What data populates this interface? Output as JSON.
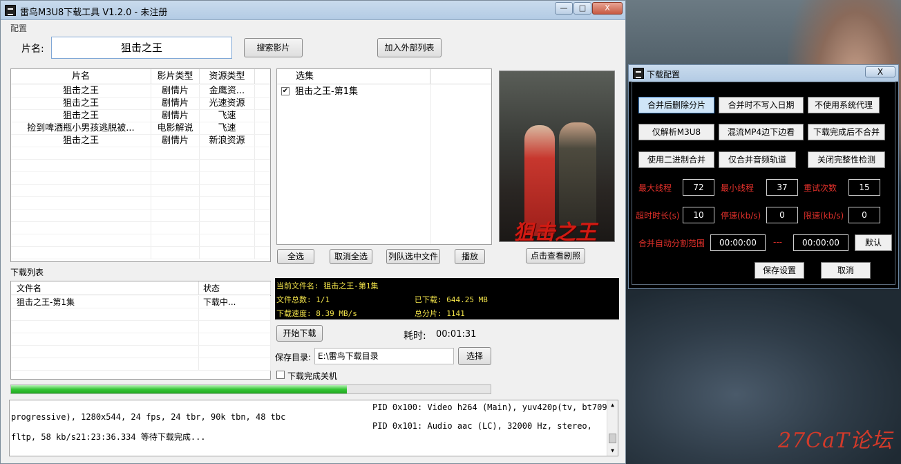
{
  "window": {
    "title": "雷鸟M3U8下载工具 V1.2.0 - 未注册",
    "minimize": "—",
    "maximize": "□",
    "close": "X"
  },
  "menu": {
    "config": "配置"
  },
  "search": {
    "label": "片名:",
    "value": "狙击之王",
    "search_button": "搜索影片",
    "add_external_button": "加入外部列表"
  },
  "results": {
    "headers": [
      "片名",
      "影片类型",
      "资源类型"
    ],
    "rows": [
      [
        "狙击之王",
        "剧情片",
        "金鹰资..."
      ],
      [
        "狙击之王",
        "剧情片",
        "光速资源"
      ],
      [
        "狙击之王",
        "剧情片",
        "飞速"
      ],
      [
        "捡到啤酒瓶小男孩逃脱被...",
        "电影解说",
        "飞速"
      ],
      [
        "狙击之王",
        "剧情片",
        "新浪资源"
      ]
    ]
  },
  "episodes": {
    "header": "选集",
    "items": [
      {
        "label": "狙击之王-第1集",
        "checked": true
      }
    ],
    "select_all": "全选",
    "deselect_all": "取消全选",
    "queue_selected": "列队选中文件",
    "play": "播放"
  },
  "poster": {
    "title_art": "狙击之王",
    "view_button": "点击查看剧照"
  },
  "downloads": {
    "section": "下载列表",
    "headers": [
      "文件名",
      "状态"
    ],
    "rows": [
      [
        "狙击之王-第1集",
        "下载中..."
      ]
    ]
  },
  "status": {
    "current_file": "当前文件名: 狙击之王-第1集",
    "total_files": "文件总数: 1/1",
    "downloaded": "已下载:  644.25 MB",
    "speed": "下载速度: 8.39 MB/s",
    "segments": "总分片: 1141"
  },
  "controls": {
    "start_button": "开始下载",
    "elapsed_label": "耗时:",
    "elapsed_value": "00:01:31",
    "save_dir_label": "保存目录:",
    "save_dir_value": "E:\\雷鸟下载目录",
    "choose_button": "选择",
    "shutdown_label": "下载完成关机",
    "shutdown_checked": false
  },
  "progress": {
    "fraction": 0.7
  },
  "log": {
    "line1": "PID 0x100: Video h264 (Main), yuv420p(tv, bt709,",
    "line2": "progressive), 1280x544, 24 fps, 24 tbr, 90k tbn, 48 tbc",
    "line3": "PID 0x101: Audio aac (LC), 32000 Hz, stereo,",
    "line4": "fltp, 58 kb/s21:23:36.334 等待下载完成..."
  },
  "config_dialog": {
    "title": "下载配置",
    "close": "X",
    "buttons_row1": [
      "合并后删除分片",
      "合并时不写入日期",
      "不使用系统代理"
    ],
    "buttons_row2": [
      "仅解析M3U8",
      "混流MP4边下边看",
      "下载完成后不合并"
    ],
    "buttons_row3": [
      "使用二进制合并",
      "仅合并音频轨道",
      "关闭完整性检测"
    ],
    "max_threads_label": "最大线程",
    "max_threads": "72",
    "min_threads_label": "最小线程",
    "min_threads": "37",
    "retry_label": "重试次数",
    "retry": "15",
    "timeout_label": "超时时长(s)",
    "timeout": "10",
    "stall_label": "停速(kb/s)",
    "stall": "0",
    "limit_label": "限速(kb/s)",
    "limit": "0",
    "range_label": "合并自动分割范围",
    "range_start": "00:00:00",
    "range_sep": "---",
    "range_end": "00:00:00",
    "default_button": "默认",
    "save_button": "保存设置",
    "cancel_button": "取消"
  },
  "desktop": {
    "watermark": "27CaT论坛"
  },
  "colors": {
    "progress": "#35c635",
    "status_text": "#f2e34a",
    "config_label": "#e0302a"
  }
}
